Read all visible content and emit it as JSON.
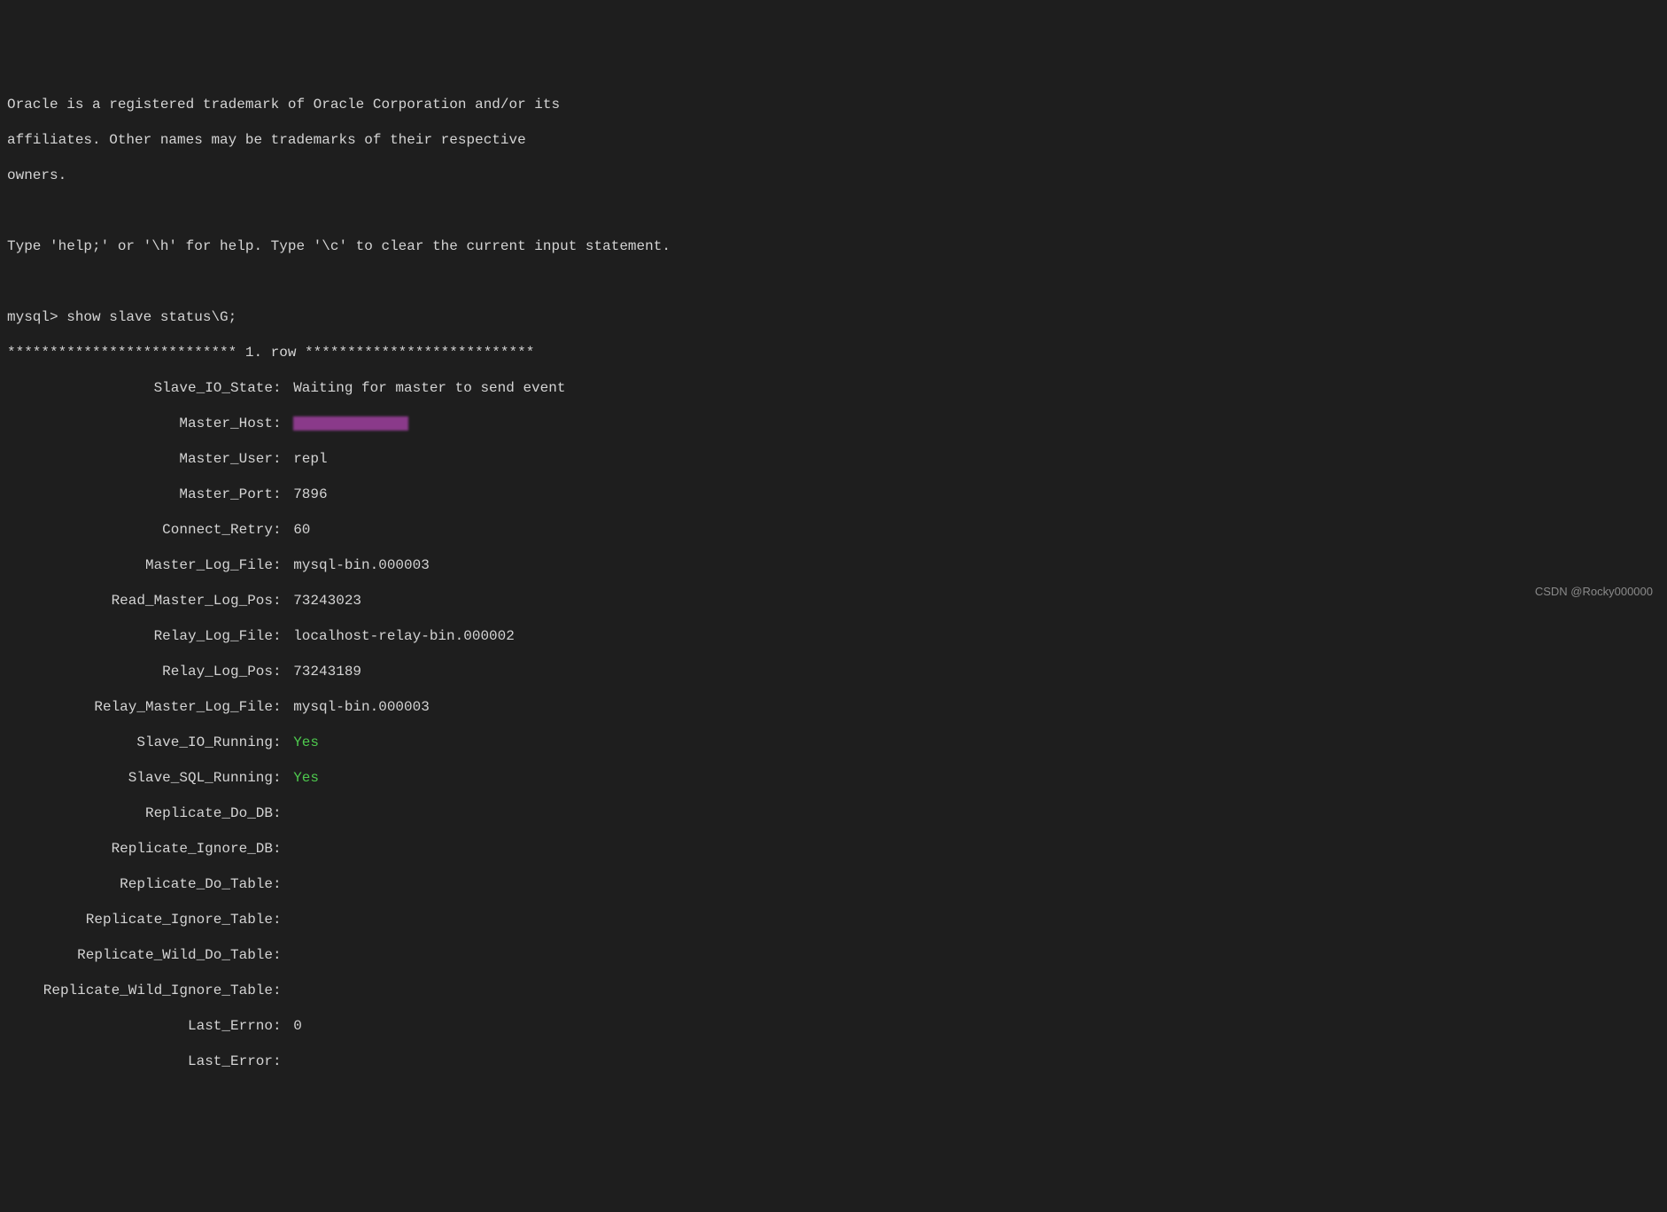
{
  "header": {
    "trademark_line1": "Oracle is a registered trademark of Oracle Corporation and/or its",
    "trademark_line2": "affiliates. Other names may be trademarks of their respective",
    "trademark_line3": "owners.",
    "help_line": "Type 'help;' or '\\h' for help. Type '\\c' to clear the current input statement."
  },
  "prompt": {
    "text": "mysql> show slave status\\G;"
  },
  "row_header": "*************************** 1. row ***************************",
  "status": {
    "Slave_IO_State": "Waiting for master to send event",
    "Master_Host": "",
    "Master_User": "repl",
    "Master_Port": "7896",
    "Connect_Retry": "60",
    "Master_Log_File": "mysql-bin.000003",
    "Read_Master_Log_Pos": "73243023",
    "Relay_Log_File": "localhost-relay-bin.000002",
    "Relay_Log_Pos": "73243189",
    "Relay_Master_Log_File": "mysql-bin.000003",
    "Slave_IO_Running": "Yes",
    "Slave_SQL_Running": "Yes",
    "Replicate_Do_DB": "",
    "Replicate_Ignore_DB": "",
    "Replicate_Do_Table": "",
    "Replicate_Ignore_Table": "",
    "Replicate_Wild_Do_Table": "",
    "Replicate_Wild_Ignore_Table": "",
    "Last_Errno": "0",
    "Last_Error": ""
  },
  "labels": {
    "Slave_IO_State": "Slave_IO_State",
    "Master_Host": "Master_Host",
    "Master_User": "Master_User",
    "Master_Port": "Master_Port",
    "Connect_Retry": "Connect_Retry",
    "Master_Log_File": "Master_Log_File",
    "Read_Master_Log_Pos": "Read_Master_Log_Pos",
    "Relay_Log_File": "Relay_Log_File",
    "Relay_Log_Pos": "Relay_Log_Pos",
    "Relay_Master_Log_File": "Relay_Master_Log_File",
    "Slave_IO_Running": "Slave_IO_Running",
    "Slave_SQL_Running": "Slave_SQL_Running",
    "Replicate_Do_DB": "Replicate_Do_DB",
    "Replicate_Ignore_DB": "Replicate_Ignore_DB",
    "Replicate_Do_Table": "Replicate_Do_Table",
    "Replicate_Ignore_Table": "Replicate_Ignore_Table",
    "Replicate_Wild_Do_Table": "Replicate_Wild_Do_Table",
    "Replicate_Wild_Ignore_Table": "Replicate_Wild_Ignore_Table",
    "Last_Errno": "Last_Errno",
    "Last_Error": "Last_Error"
  },
  "watermark": "CSDN @Rocky000000"
}
